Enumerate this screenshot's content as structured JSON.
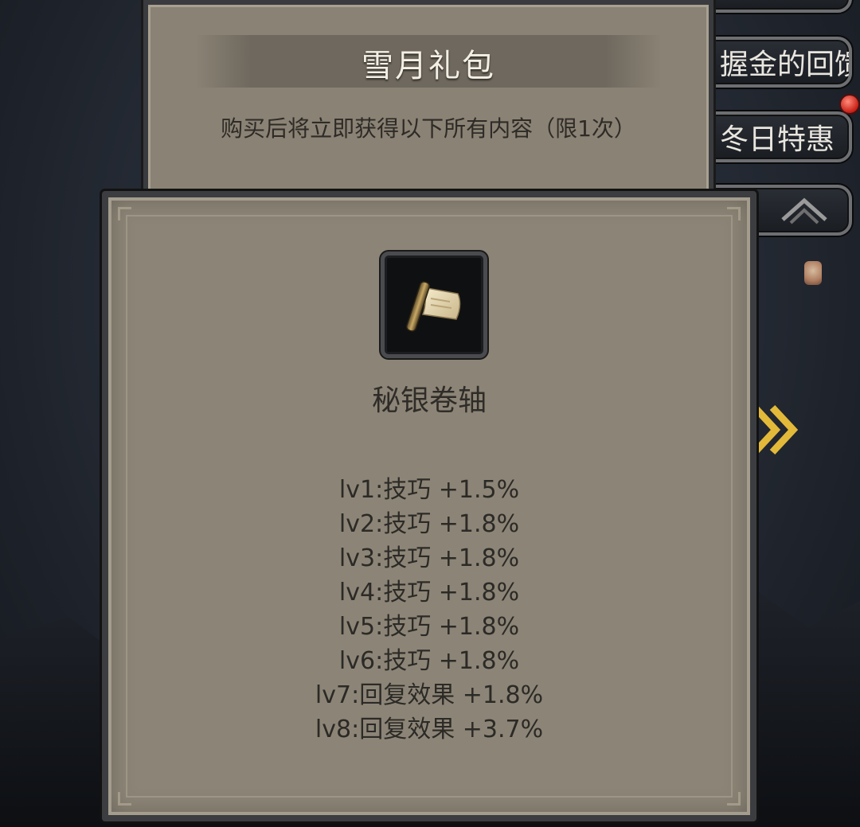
{
  "side_tabs": {
    "top_label": "",
    "invest_label": "握金的回馈",
    "winter_label": "冬日特惠"
  },
  "gift": {
    "title": "雪月礼包",
    "description": "购买后将立即获得以下所有内容（限1次）"
  },
  "item": {
    "icon": "scroll-icon",
    "name": "秘银卷轴",
    "stats": [
      "lv1:技巧 +1.5%",
      "lv2:技巧 +1.8%",
      "lv3:技巧 +1.8%",
      "lv4:技巧 +1.8%",
      "lv5:技巧 +1.8%",
      "lv6:技巧 +1.8%",
      "lv7:回复效果 +1.8%",
      "lv8:回复效果 +3.7%"
    ]
  },
  "colors": {
    "panel": "#8c8577",
    "text": "#2c2a26",
    "accent_gold": "#e3b93a",
    "notification_red": "#c81e14"
  }
}
